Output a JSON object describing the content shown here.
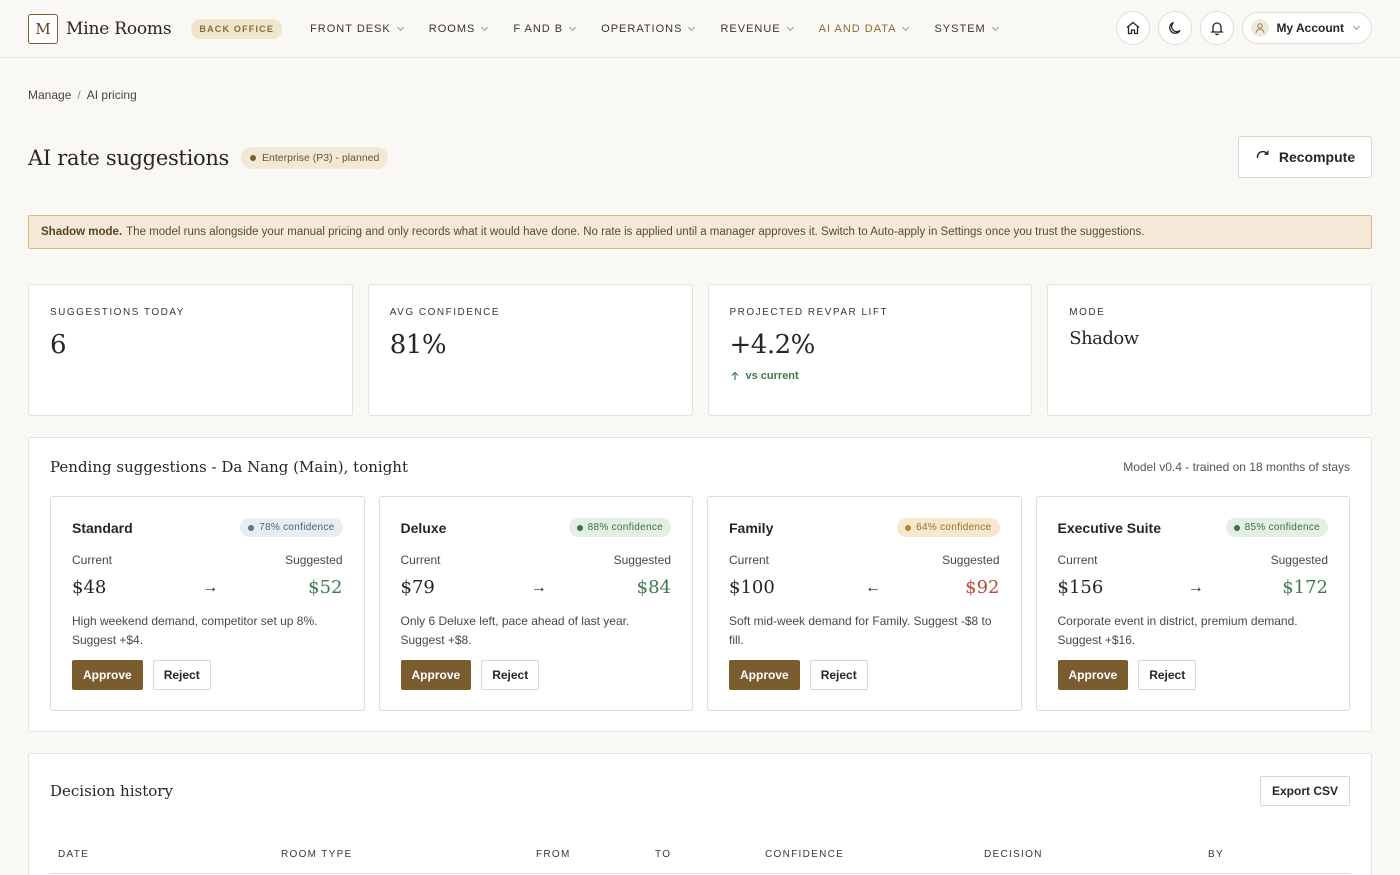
{
  "brand": {
    "logo_letter": "M",
    "name": "Mine Rooms",
    "badge": "BACK OFFICE"
  },
  "nav": {
    "items": [
      {
        "label": "FRONT DESK",
        "accent": false
      },
      {
        "label": "ROOMS",
        "accent": false
      },
      {
        "label": "F AND B",
        "accent": false
      },
      {
        "label": "OPERATIONS",
        "accent": false
      },
      {
        "label": "REVENUE",
        "accent": false
      },
      {
        "label": "AI AND DATA",
        "accent": true
      },
      {
        "label": "SYSTEM",
        "accent": false
      }
    ],
    "account_label": "My Account"
  },
  "breadcrumb": {
    "root": "Manage",
    "sep": "/",
    "current": "AI pricing"
  },
  "page": {
    "title": "AI rate suggestions",
    "plan_badge": "Enterprise (P3) - planned",
    "recompute_label": "Recompute"
  },
  "banner": {
    "bold": "Shadow mode.",
    "text": "The model runs alongside your manual pricing and only records what it would have done. No rate is applied until a manager approves it. Switch to Auto-apply in Settings once you trust the suggestions."
  },
  "stats": [
    {
      "label": "SUGGESTIONS TODAY",
      "value": "6",
      "sub": ""
    },
    {
      "label": "AVG CONFIDENCE",
      "value": "81%",
      "sub": ""
    },
    {
      "label": "PROJECTED REVPAR LIFT",
      "value": "+4.2%",
      "sub": "vs current"
    },
    {
      "label": "MODE",
      "value": "Shadow",
      "sub": ""
    }
  ],
  "pending": {
    "title": "Pending suggestions - Da Nang (Main), tonight",
    "meta": "Model v0.4 - trained on 18 months of stays",
    "current_label": "Current",
    "suggested_label": "Suggested",
    "approve_label": "Approve",
    "reject_label": "Reject",
    "cards": [
      {
        "room": "Standard",
        "confidence": "78% confidence",
        "tone": "blue",
        "current": "$48",
        "suggested": "$52",
        "direction": "up",
        "reason": "High weekend demand, competitor set up 8%. Suggest +$4."
      },
      {
        "room": "Deluxe",
        "confidence": "88% confidence",
        "tone": "green",
        "current": "$79",
        "suggested": "$84",
        "direction": "up",
        "reason": "Only 6 Deluxe left, pace ahead of last year. Suggest +$8."
      },
      {
        "room": "Family",
        "confidence": "64% confidence",
        "tone": "amber",
        "current": "$100",
        "suggested": "$92",
        "direction": "down",
        "reason": "Soft mid-week demand for Family. Suggest -$8 to fill."
      },
      {
        "room": "Executive Suite",
        "confidence": "85% confidence",
        "tone": "green",
        "current": "$156",
        "suggested": "$172",
        "direction": "up",
        "reason": "Corporate event in district, premium demand. Suggest +$16."
      }
    ]
  },
  "history": {
    "title": "Decision history",
    "export_label": "Export CSV",
    "columns": [
      "DATE",
      "ROOM TYPE",
      "FROM",
      "TO",
      "CONFIDENCE",
      "DECISION",
      "BY"
    ]
  },
  "colors": {
    "accent": "#7a5c2e",
    "up": "#3f7a4e",
    "down": "#b34a3c",
    "background": "#faf8f4"
  }
}
